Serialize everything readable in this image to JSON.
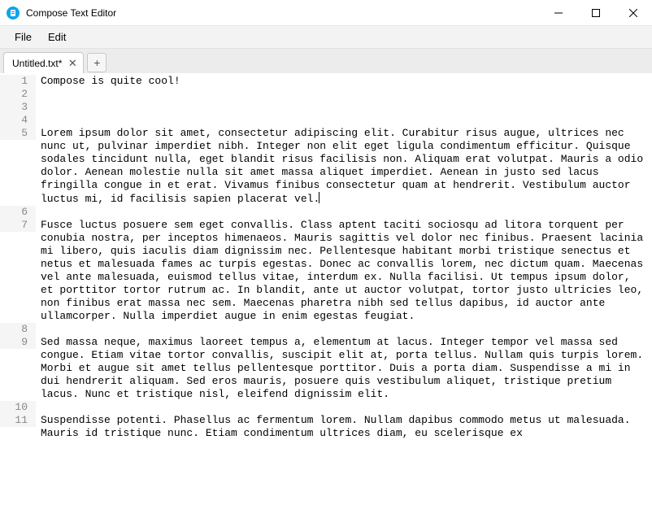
{
  "window": {
    "title": "Compose Text Editor"
  },
  "menu": {
    "items": [
      "File",
      "Edit"
    ]
  },
  "tabs": {
    "items": [
      {
        "label": "Untitled.txt*"
      }
    ],
    "new_tab_glyph": "+"
  },
  "editor": {
    "lines": [
      {
        "num": "1",
        "text": "Compose is quite cool!"
      },
      {
        "num": "2",
        "text": ""
      },
      {
        "num": "3",
        "text": ""
      },
      {
        "num": "4",
        "text": ""
      },
      {
        "num": "5",
        "text": "Lorem ipsum dolor sit amet, consectetur adipiscing elit. Curabitur risus augue, ultrices nec nunc ut, pulvinar imperdiet nibh. Integer non elit eget ligula condimentum efficitur. Quisque sodales tincidunt nulla, eget blandit risus facilisis non. Aliquam erat volutpat. Mauris a odio dolor. Aenean molestie nulla sit amet massa aliquet imperdiet. Aenean in justo sed lacus fringilla congue in et erat. Vivamus finibus consectetur quam at hendrerit. Vestibulum auctor luctus mi, id facilisis sapien placerat vel.",
        "caret_after": true
      },
      {
        "num": "6",
        "text": ""
      },
      {
        "num": "7",
        "text": "Fusce luctus posuere sem eget convallis. Class aptent taciti sociosqu ad litora torquent per conubia nostra, per inceptos himenaeos. Mauris sagittis vel dolor nec finibus. Praesent lacinia mi libero, quis iaculis diam dignissim nec. Pellentesque habitant morbi tristique senectus et netus et malesuada fames ac turpis egestas. Donec ac convallis lorem, nec dictum quam. Maecenas vel ante malesuada, euismod tellus vitae, interdum ex. Nulla facilisi. Ut tempus ipsum dolor, et porttitor tortor rutrum ac. In blandit, ante ut auctor volutpat, tortor justo ultricies leo, non finibus erat massa nec sem. Maecenas pharetra nibh sed tellus dapibus, id auctor ante ullamcorper. Nulla imperdiet augue in enim egestas feugiat."
      },
      {
        "num": "8",
        "text": ""
      },
      {
        "num": "9",
        "text": "Sed massa neque, maximus laoreet tempus a, elementum at lacus. Integer tempor vel massa sed congue. Etiam vitae tortor convallis, suscipit elit at, porta tellus. Nullam quis turpis lorem. Morbi et augue sit amet tellus pellentesque porttitor. Duis a porta diam. Suspendisse a mi in dui hendrerit aliquam. Sed eros mauris, posuere quis vestibulum aliquet, tristique pretium lacus. Nunc et tristique nisl, eleifend dignissim elit."
      },
      {
        "num": "10",
        "text": ""
      },
      {
        "num": "11",
        "text": "Suspendisse potenti. Phasellus ac fermentum lorem. Nullam dapibus commodo metus ut malesuada. Mauris id tristique nunc. Etiam condimentum ultrices diam, eu scelerisque ex"
      }
    ]
  }
}
